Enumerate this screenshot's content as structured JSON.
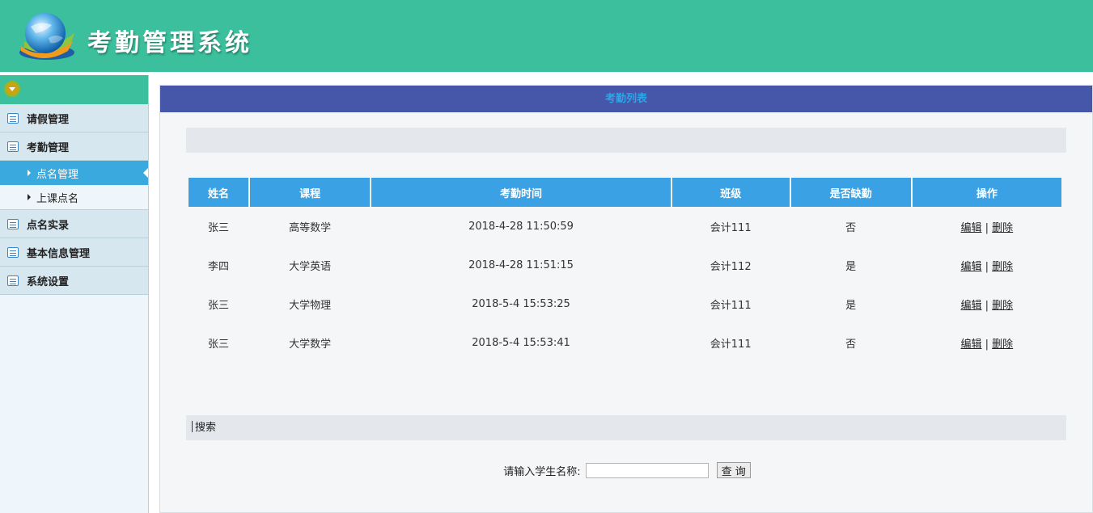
{
  "header": {
    "title": "考勤管理系统",
    "logo_icon": "globe-arrow-logo-icon"
  },
  "colors": {
    "header_bg": "#3bbf9c",
    "panel_title_bg": "#4656a9",
    "table_head_bg": "#3aa2e4",
    "active_menu_bg": "#3aa9de"
  },
  "sidebar": {
    "toggle_icon": "collapse-toggle-icon",
    "groups": [
      {
        "label": "请假管理",
        "icon": "list-icon"
      },
      {
        "label": "考勤管理",
        "icon": "list-icon",
        "items": [
          {
            "label": "点名管理",
            "active": true
          },
          {
            "label": "上课点名",
            "active": false
          }
        ]
      },
      {
        "label": "点名实录",
        "icon": "list-icon"
      },
      {
        "label": "基本信息管理",
        "icon": "list-icon"
      },
      {
        "label": "系统设置",
        "icon": "list-icon"
      }
    ]
  },
  "main": {
    "title": "考勤列表",
    "table": {
      "headers": [
        "姓名",
        "课程",
        "考勤时间",
        "班级",
        "是否缺勤",
        "操作"
      ],
      "rows": [
        {
          "name": "张三",
          "course": "高等数学",
          "time": "2018-4-28 11:50:59",
          "class": "会计111",
          "absent": "否"
        },
        {
          "name": "李四",
          "course": "大学英语",
          "time": "2018-4-28 11:51:15",
          "class": "会计112",
          "absent": "是"
        },
        {
          "name": "张三",
          "course": "大学物理",
          "time": "2018-5-4 15:53:25",
          "class": "会计111",
          "absent": "是"
        },
        {
          "name": "张三",
          "course": "大学数学",
          "time": "2018-5-4 15:53:41",
          "class": "会计111",
          "absent": "否"
        }
      ],
      "edit_label": "编辑",
      "separator": "|",
      "delete_label": "删除"
    },
    "search": {
      "section_label": "搜索",
      "field_label": "请输入学生名称:",
      "input_value": "",
      "button_label": "查 询"
    }
  }
}
